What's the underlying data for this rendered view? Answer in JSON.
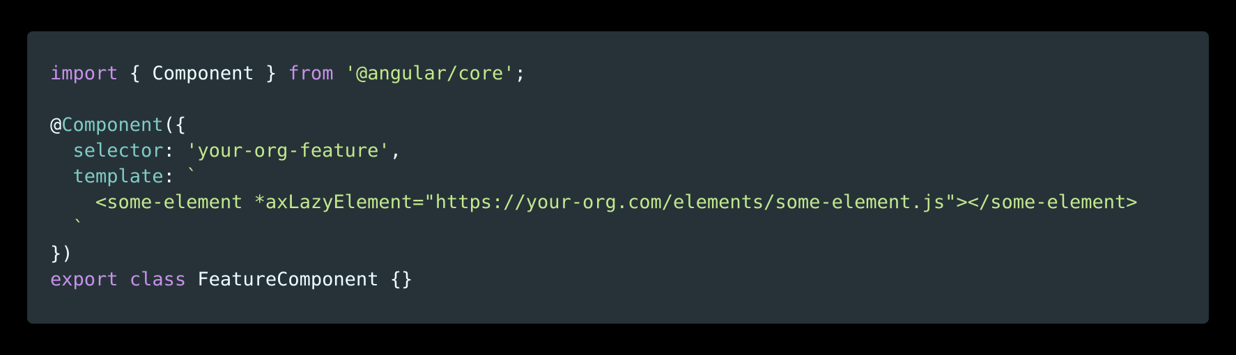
{
  "colors": {
    "page_background": "#000000",
    "panel_background": "#263238",
    "keyword": "#c792ea",
    "string": "#c3e88d",
    "decorator": "#80cbc4",
    "text": "#eeffff"
  },
  "code": {
    "line1": {
      "import_kw": "import",
      "open_brace": " { ",
      "component_name": "Component",
      "close_brace": " } ",
      "from_kw": "from",
      "space": " ",
      "module_str": "'@angular/core'",
      "semicolon": ";"
    },
    "line3": {
      "at": "@",
      "decorator": "Component",
      "paren_open": "({"
    },
    "line4": {
      "indent": "  ",
      "key": "selector",
      "colon": ": ",
      "value": "'your-org-feature'",
      "comma": ","
    },
    "line5": {
      "indent": "  ",
      "key": "template",
      "colon": ": ",
      "backtick": "`"
    },
    "line6": {
      "indent": "    ",
      "content": "<some-element *axLazyElement=\"https://your-org.com/elements/some-element.js\"></some-element>"
    },
    "line7": {
      "indent": "  ",
      "backtick": "`"
    },
    "line8": {
      "content": "})"
    },
    "line9": {
      "export_kw": "export",
      "space1": " ",
      "class_kw": "class",
      "space2": " ",
      "class_name": "FeatureComponent",
      "body": " {}"
    }
  }
}
